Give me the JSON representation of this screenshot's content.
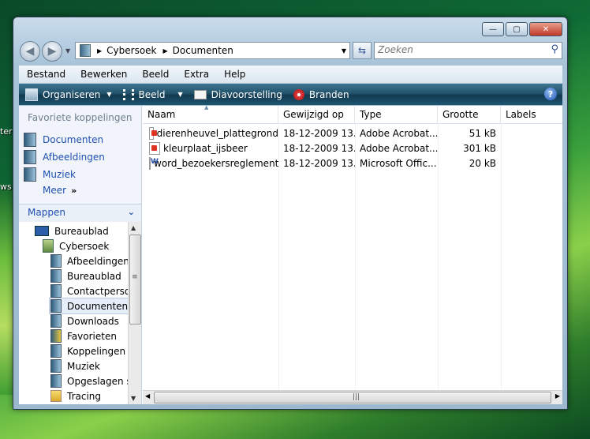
{
  "desktop": {
    "left_label_1": "ter",
    "left_label_2": "ws"
  },
  "window": {
    "caption_buttons": {
      "minimize": "—",
      "maximize": "▢",
      "close": "✕"
    },
    "nav": {
      "back_icon": "◀",
      "forward_icon": "▶"
    },
    "address": {
      "crumbs": [
        "Cybersoek",
        "Documenten"
      ],
      "separator": "▶"
    },
    "search": {
      "placeholder": "Zoeken"
    },
    "menu": [
      "Bestand",
      "Bewerken",
      "Beeld",
      "Extra",
      "Help"
    ],
    "toolbar": {
      "organize": "Organiseren",
      "view": "Beeld",
      "slideshow": "Diavoorstelling",
      "burn": "Branden",
      "help": "?"
    },
    "nav_pane": {
      "favorites_title": "Favoriete koppelingen",
      "favorites": [
        "Documenten",
        "Afbeeldingen",
        "Muziek"
      ],
      "more": "Meer",
      "more_chevron": "»",
      "folders_title": "Mappen",
      "tree": [
        {
          "label": "Bureaublad",
          "level": 0
        },
        {
          "label": "Cybersoek",
          "level": 1
        },
        {
          "label": "Afbeeldingen",
          "level": 2
        },
        {
          "label": "Bureaublad",
          "level": 2
        },
        {
          "label": "Contactpersonen",
          "level": 2
        },
        {
          "label": "Documenten",
          "level": 2,
          "selected": true
        },
        {
          "label": "Downloads",
          "level": 2
        },
        {
          "label": "Favorieten",
          "level": 2
        },
        {
          "label": "Koppelingen",
          "level": 2
        },
        {
          "label": "Muziek",
          "level": 2
        },
        {
          "label": "Opgeslagen spellen",
          "level": 2
        },
        {
          "label": "Tracing",
          "level": 2
        }
      ]
    },
    "columns": [
      "Naam",
      "Gewijzigd op",
      "Type",
      "Grootte",
      "Labels"
    ],
    "files": [
      {
        "name": "dierenheuvel_plattegrond",
        "modified": "18-12-2009 13...",
        "type": "Adobe Acrobat...",
        "size": "51 kB",
        "icon": "pdf-icon"
      },
      {
        "name": "kleurplaat_ijsbeer",
        "modified": "18-12-2009 13...",
        "type": "Adobe Acrobat...",
        "size": "301 kB",
        "icon": "pdf-icon"
      },
      {
        "name": "word_bezoekersreglement",
        "modified": "18-12-2009 13...",
        "type": "Microsoft Offic...",
        "size": "20 kB",
        "icon": "word-doc-icon"
      }
    ]
  }
}
